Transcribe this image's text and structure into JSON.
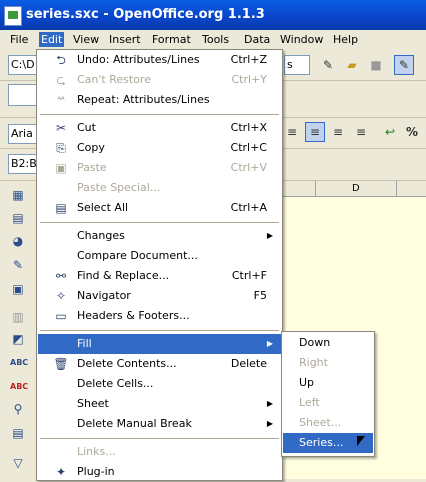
{
  "window": {
    "title": "series.sxc - OpenOffice.org 1.1.3"
  },
  "menubar": {
    "file": "File",
    "edit": "Edit",
    "view": "View",
    "insert": "Insert",
    "format": "Format",
    "tools": "Tools",
    "data": "Data",
    "window": "Window",
    "help": "Help"
  },
  "toolbar": {
    "path_value": "C:\\D",
    "style_value": "s",
    "font_value": "Aria",
    "cellref_value": "B2:B"
  },
  "grid": {
    "col_d": "D"
  },
  "edit_menu": {
    "undo": {
      "label": "Undo: Attributes/Lines",
      "accel": "Ctrl+Z"
    },
    "restore": {
      "label": "Can't Restore",
      "accel": "Ctrl+Y"
    },
    "repeat": {
      "label": "Repeat: Attributes/Lines"
    },
    "cut": {
      "label": "Cut",
      "accel": "Ctrl+X"
    },
    "copy": {
      "label": "Copy",
      "accel": "Ctrl+C"
    },
    "paste": {
      "label": "Paste",
      "accel": "Ctrl+V"
    },
    "paste_special": {
      "label": "Paste Special..."
    },
    "select_all": {
      "label": "Select All",
      "accel": "Ctrl+A"
    },
    "changes": {
      "label": "Changes"
    },
    "compare": {
      "label": "Compare Document..."
    },
    "find_replace": {
      "label": "Find & Replace...",
      "accel": "Ctrl+F"
    },
    "navigator": {
      "label": "Navigator",
      "accel": "F5"
    },
    "headers_footers": {
      "label": "Headers & Footers..."
    },
    "fill": {
      "label": "Fill"
    },
    "delete_contents": {
      "label": "Delete Contents...",
      "accel": "Delete"
    },
    "delete_cells": {
      "label": "Delete Cells..."
    },
    "sheet": {
      "label": "Sheet"
    },
    "delete_break": {
      "label": "Delete Manual Break"
    },
    "links": {
      "label": "Links..."
    },
    "plugin": {
      "label": "Plug-in"
    }
  },
  "fill_submenu": {
    "down": "Down",
    "right": "Right",
    "up": "Up",
    "left": "Left",
    "sheet": "Sheet...",
    "series": "Series..."
  },
  "colors": {
    "highlight": "#316ac5",
    "menu_bg": "#ffffff",
    "cell_bg": "#ffffe0",
    "titlebar": "#0a54d8"
  }
}
